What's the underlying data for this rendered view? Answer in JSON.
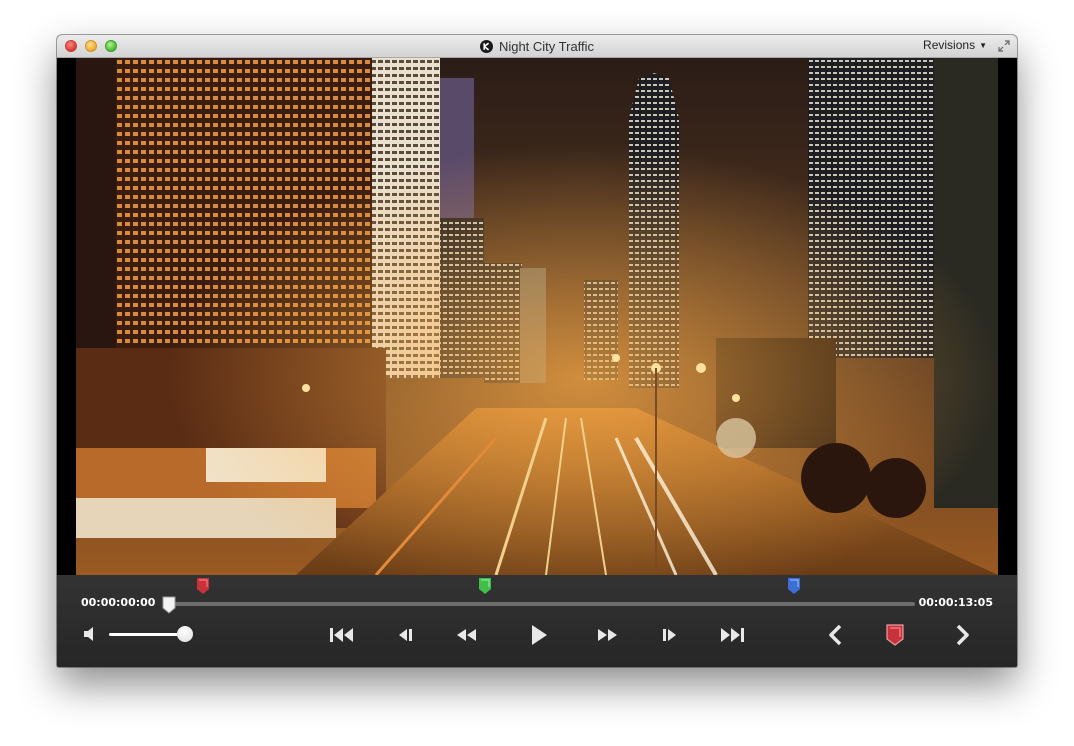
{
  "window": {
    "title": "Night City Traffic",
    "menu": {
      "revisions_label": "Revisions"
    }
  },
  "player": {
    "current_time": "00:00:00:00",
    "duration": "00:00:13:05",
    "playhead_fraction": 0.0,
    "volume_fraction": 1.0,
    "markers": [
      {
        "color": "#c8323a",
        "fraction": 0.045
      },
      {
        "color": "#3fbf4a",
        "fraction": 0.423
      },
      {
        "color": "#3b6fd6",
        "fraction": 0.838
      }
    ]
  },
  "colors": {
    "control_bg": "#2b2b2b",
    "accent_red": "#c8323a",
    "accent_green": "#3fbf4a",
    "accent_blue": "#3b6fd6"
  },
  "icons": {
    "volume": "speaker-icon",
    "go_to_start": "skip-to-start-icon",
    "step_back": "step-back-icon",
    "rewind": "rewind-icon",
    "play": "play-icon",
    "fast_forward": "fast-forward-icon",
    "step_forward": "step-forward-icon",
    "go_to_end": "skip-to-end-icon",
    "prev_marker": "chevron-left-icon",
    "add_marker": "marker-flag-icon",
    "next_marker": "chevron-right-icon"
  }
}
